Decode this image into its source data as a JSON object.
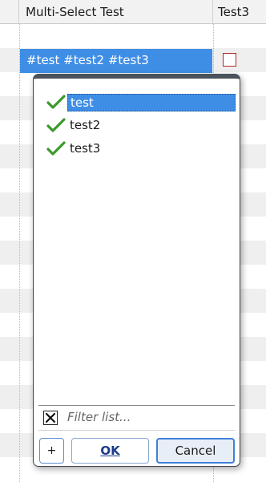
{
  "table": {
    "columns": [
      "",
      "Multi-Select Test",
      "Test3"
    ],
    "selected_cell_value": "#test #test2 #test3"
  },
  "popup": {
    "items": [
      {
        "label": "test",
        "checked": true,
        "selected": true
      },
      {
        "label": "test2",
        "checked": true,
        "selected": false
      },
      {
        "label": "test3",
        "checked": true,
        "selected": false
      }
    ],
    "filter_placeholder": "Filter list...",
    "filter_clear_icon": "x-icon",
    "buttons": {
      "add_label": "+",
      "ok_label": "OK",
      "cancel_label": "Cancel"
    }
  },
  "colors": {
    "selection": "#3f8ee6",
    "check": "#3a9a2a",
    "checkbox_border": "#b02a2a"
  }
}
